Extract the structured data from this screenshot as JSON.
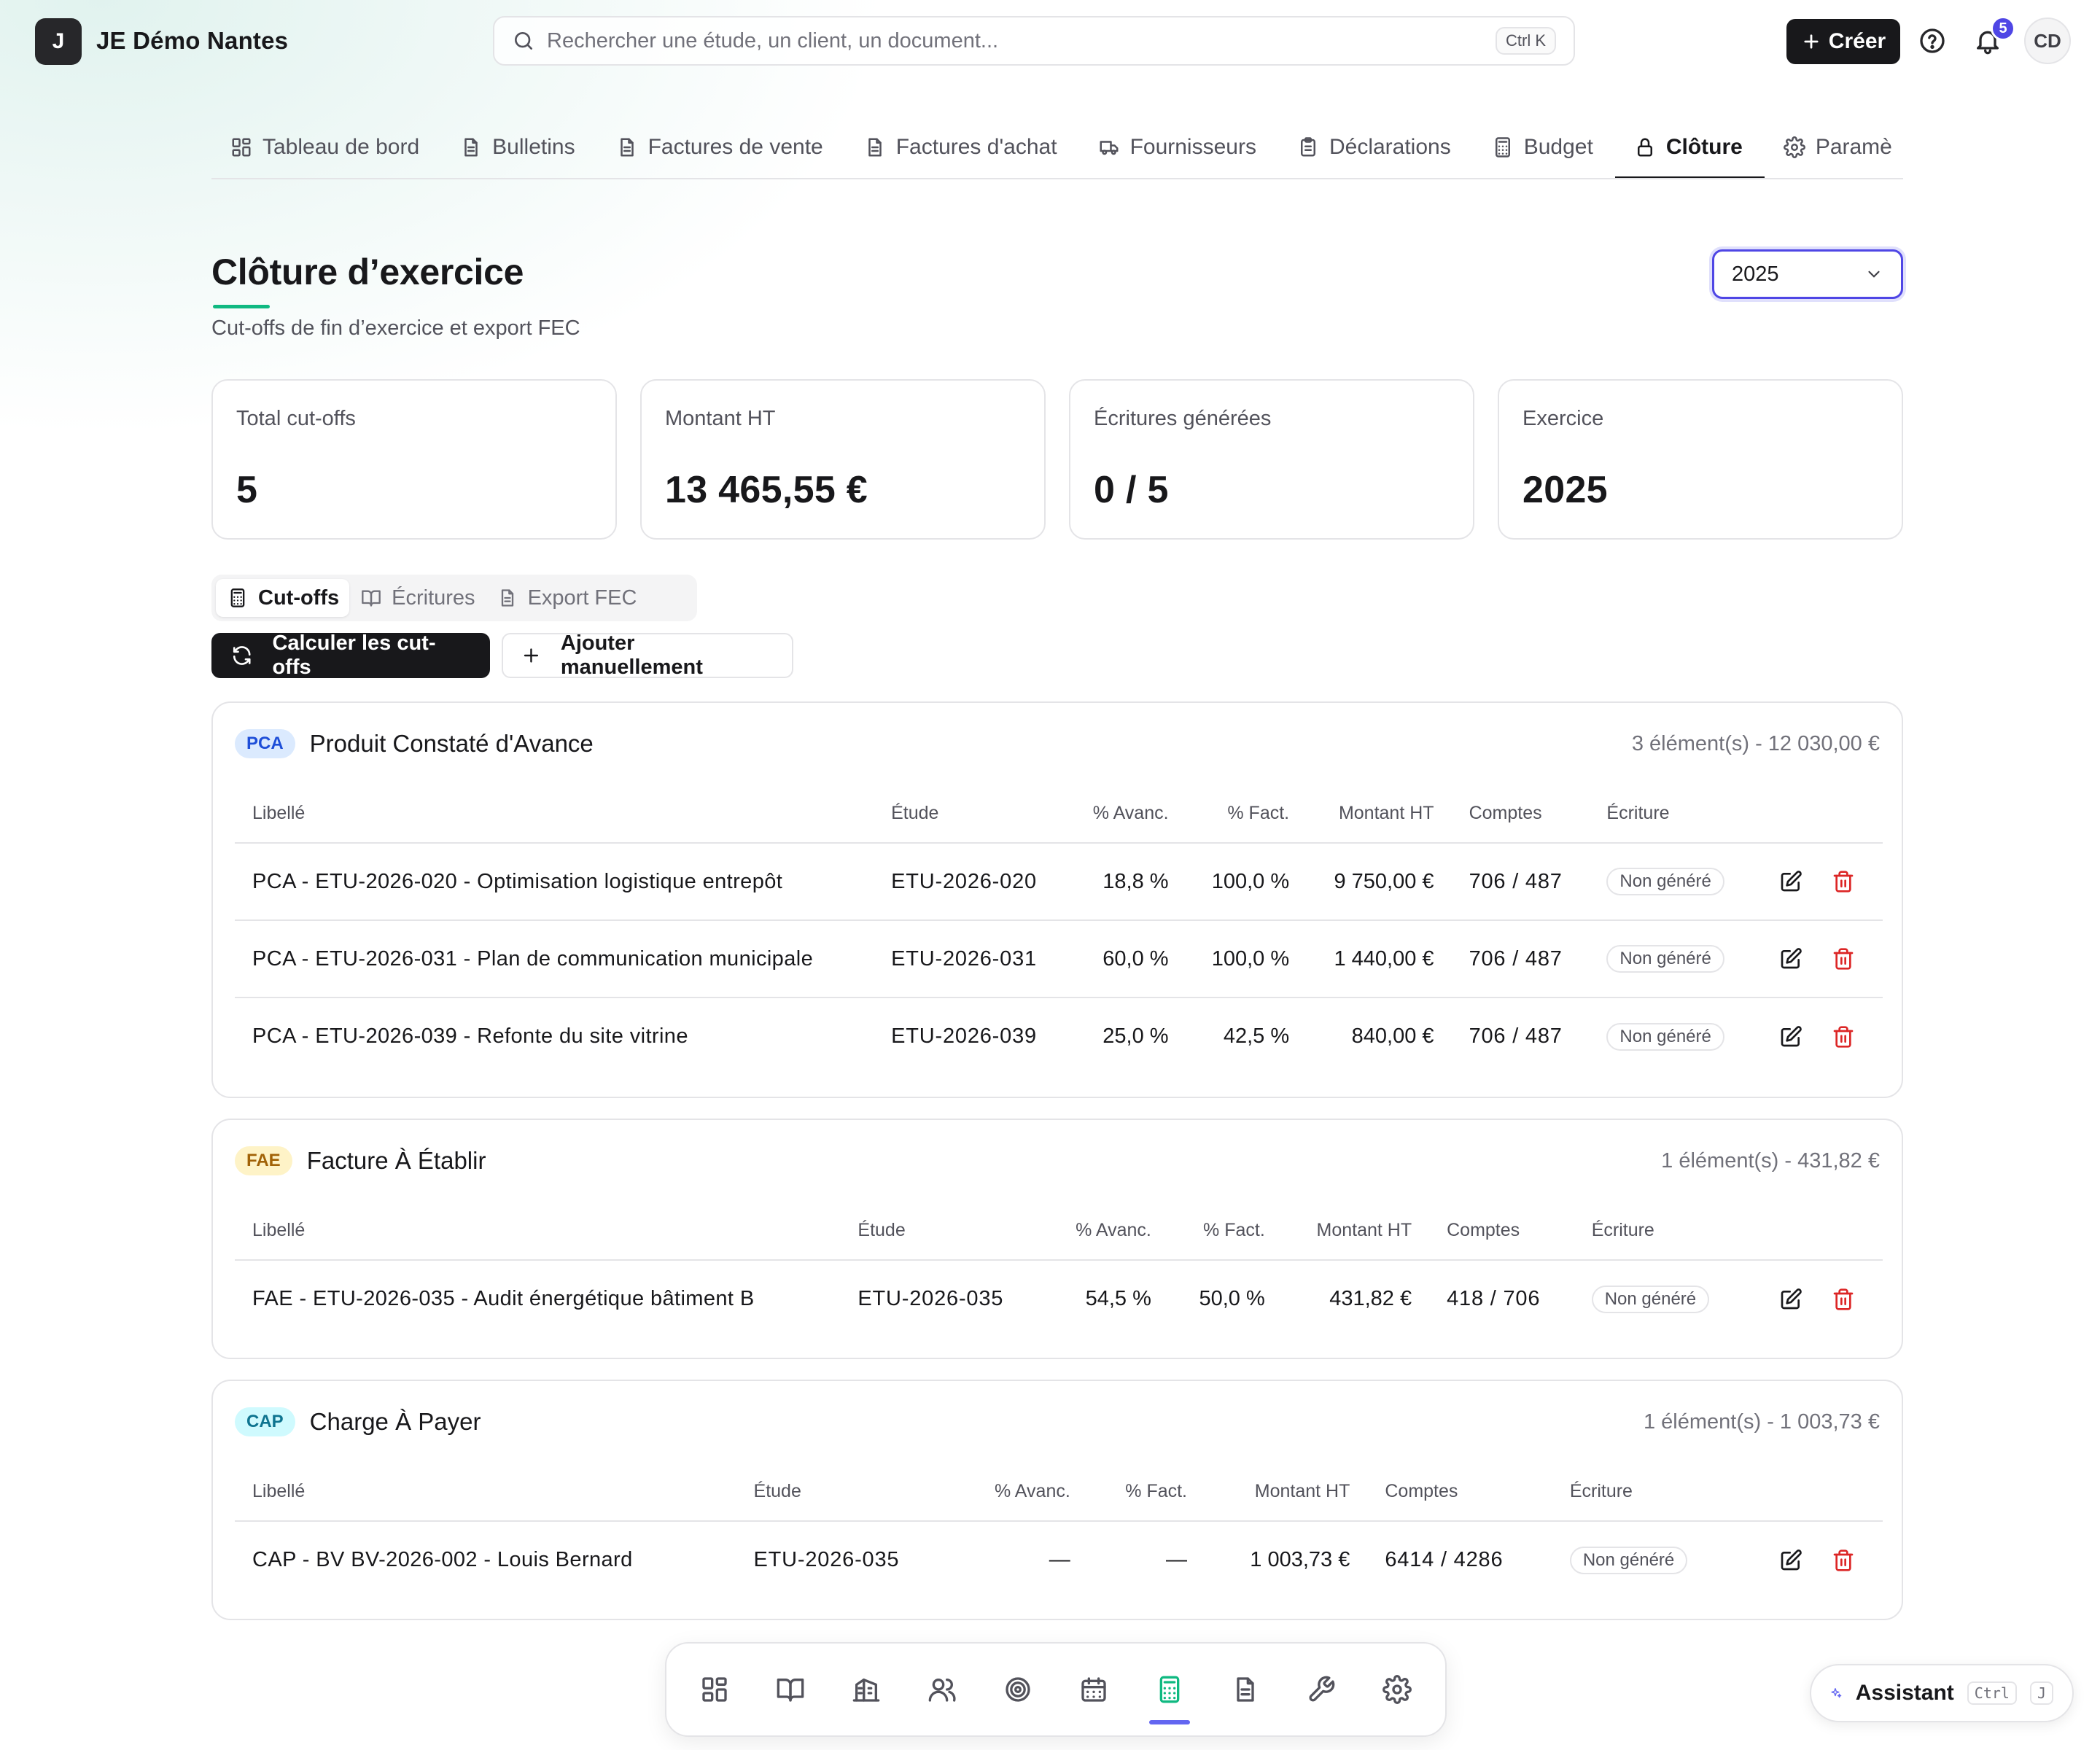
{
  "org": {
    "logo_letter": "J",
    "name": "JE Démo Nantes"
  },
  "search": {
    "placeholder": "Rechercher une étude, un client, un document...",
    "shortcut": "Ctrl K"
  },
  "header": {
    "create_label": "Créer",
    "notifications_count": "5",
    "user_initials": "CD"
  },
  "nav": {
    "tabs": [
      {
        "label": "Tableau de bord",
        "icon": "dashboard-icon"
      },
      {
        "label": "Bulletins",
        "icon": "document-icon"
      },
      {
        "label": "Factures de vente",
        "icon": "document-icon"
      },
      {
        "label": "Factures d'achat",
        "icon": "document-icon"
      },
      {
        "label": "Fournisseurs",
        "icon": "truck-icon"
      },
      {
        "label": "Déclarations",
        "icon": "clipboard-icon"
      },
      {
        "label": "Budget",
        "icon": "calculator-icon"
      },
      {
        "label": "Clôture",
        "icon": "lock-icon",
        "active": true
      },
      {
        "label": "Paramè",
        "icon": "gear-icon"
      }
    ]
  },
  "page": {
    "title": "Clôture d’exercice",
    "subtitle": "Cut-offs de fin d’exercice et export FEC",
    "year": "2025"
  },
  "stats": [
    {
      "label": "Total cut-offs",
      "value": "5"
    },
    {
      "label": "Montant HT",
      "value": "13 465,55 €"
    },
    {
      "label": "Écritures générées",
      "value": "0 / 5"
    },
    {
      "label": "Exercice",
      "value": "2025"
    }
  ],
  "segments": [
    {
      "label": "Cut-offs",
      "icon": "calculator-icon",
      "active": true
    },
    {
      "label": "Écritures",
      "icon": "book-icon"
    },
    {
      "label": "Export FEC",
      "icon": "document-icon"
    }
  ],
  "actions": {
    "compute": "Calculer les cut-offs",
    "add": "Ajouter manuellement"
  },
  "columns": [
    "Libellé",
    "Étude",
    "% Avanc.",
    "% Fact.",
    "Montant HT",
    "Comptes",
    "Écriture"
  ],
  "sections": [
    {
      "tag": "PCA",
      "title": "Produit Constaté d'Avance",
      "summary": "3 élément(s) - 12 030,00 €",
      "rows": [
        {
          "libelle": "PCA - ETU-2026-020 - Optimisation logistique entrepôt",
          "etude": "ETU-2026-020",
          "avanc": "18,8 %",
          "fact": "100,0 %",
          "montant": "9 750,00 €",
          "comptes": "706 / 487",
          "ecriture": "Non généré"
        },
        {
          "libelle": "PCA - ETU-2026-031 - Plan de communication municipale",
          "etude": "ETU-2026-031",
          "avanc": "60,0 %",
          "fact": "100,0 %",
          "montant": "1 440,00 €",
          "comptes": "706 / 487",
          "ecriture": "Non généré"
        },
        {
          "libelle": "PCA - ETU-2026-039 - Refonte du site vitrine",
          "etude": "ETU-2026-039",
          "avanc": "25,0 %",
          "fact": "42,5 %",
          "montant": "840,00 €",
          "comptes": "706 / 487",
          "ecriture": "Non généré"
        }
      ]
    },
    {
      "tag": "FAE",
      "title": "Facture À Établir",
      "summary": "1 élément(s) - 431,82 €",
      "rows": [
        {
          "libelle": "FAE - ETU-2026-035 - Audit énergétique bâtiment B",
          "etude": "ETU-2026-035",
          "avanc": "54,5 %",
          "fact": "50,0 %",
          "montant": "431,82 €",
          "comptes": "418 / 706",
          "ecriture": "Non généré"
        }
      ]
    },
    {
      "tag": "CAP",
      "title": "Charge À Payer",
      "summary": "1 élément(s) - 1 003,73 €",
      "rows": [
        {
          "libelle": "CAP - BV BV-2026-002 - Louis Bernard",
          "etude": "ETU-2026-035",
          "avanc": "—",
          "fact": "—",
          "montant": "1 003,73 €",
          "comptes": "6414 / 4286",
          "ecriture": "Non généré"
        }
      ]
    }
  ],
  "dock": [
    {
      "icon": "dashboard-icon"
    },
    {
      "icon": "book-icon"
    },
    {
      "icon": "building-icon"
    },
    {
      "icon": "users-icon"
    },
    {
      "icon": "target-icon"
    },
    {
      "icon": "calendar-icon"
    },
    {
      "icon": "calculator-icon",
      "active": true
    },
    {
      "icon": "document-icon"
    },
    {
      "icon": "wrench-icon"
    },
    {
      "icon": "gear-icon"
    }
  ],
  "assistant": {
    "label": "Assistant",
    "key1": "Ctrl",
    "key2": "J"
  }
}
